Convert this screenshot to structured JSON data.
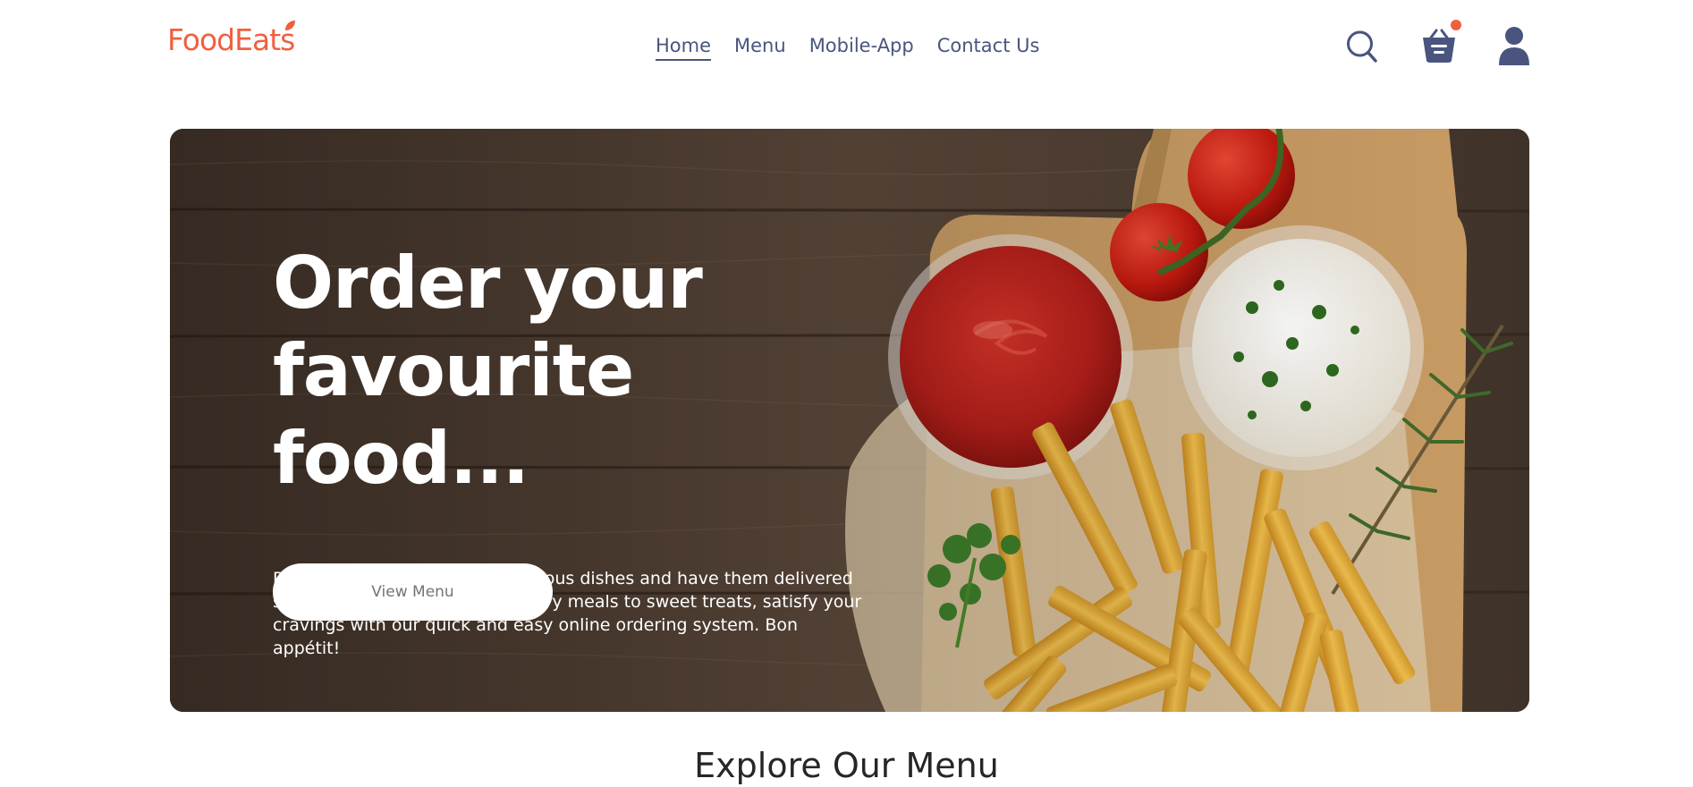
{
  "brand": {
    "name": "FoodEats",
    "accent_color": "#f0603f",
    "text_color": "#49557e"
  },
  "nav": {
    "items": [
      {
        "label": "Home",
        "active": true
      },
      {
        "label": "Menu",
        "active": false
      },
      {
        "label": "Mobile-App",
        "active": false
      },
      {
        "label": "Contact Us",
        "active": false
      }
    ],
    "icons": [
      "search-icon",
      "basket-icon",
      "profile-icon"
    ],
    "cart_has_items": true
  },
  "hero": {
    "title_line1": "Order your",
    "title_line2": "favourite food...",
    "description": "Discover a wide variety of delicious dishes and have them delivered straight to your door. From savory meals to sweet treats, satisfy your cravings with our quick and easy online ordering system. Bon appétit!",
    "button_label": "View Menu"
  },
  "section": {
    "explore_title": "Explore Our Menu"
  }
}
